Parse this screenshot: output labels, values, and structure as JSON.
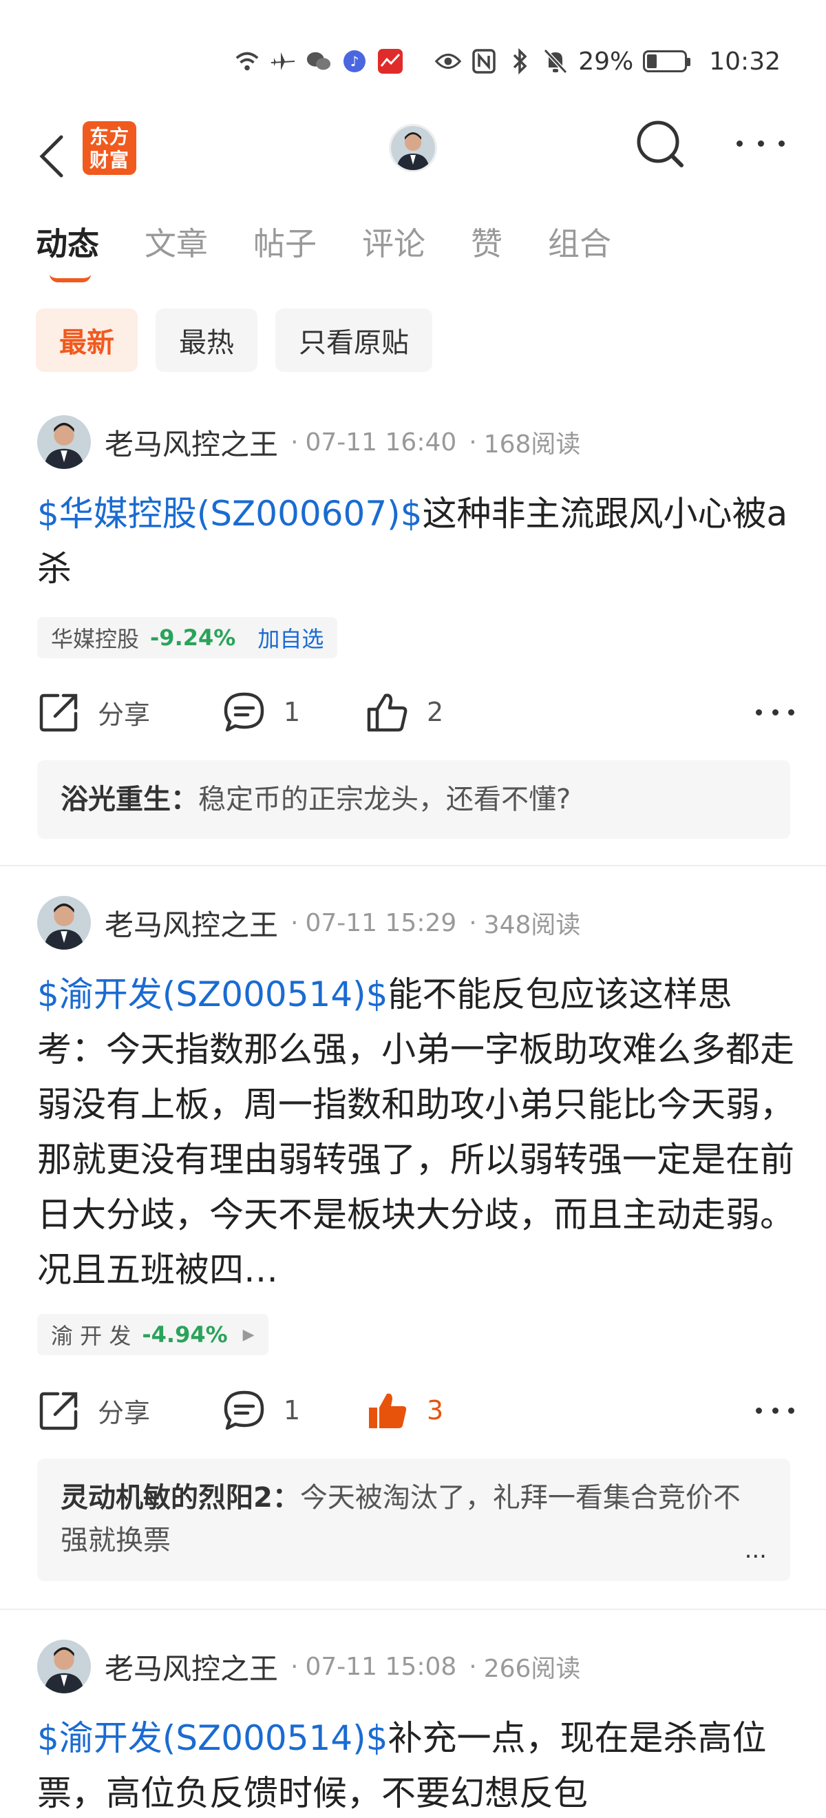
{
  "status_bar": {
    "battery": "29%",
    "time": "10:32"
  },
  "header": {
    "logo_line1": "东方",
    "logo_line2": "财富"
  },
  "tabs": [
    {
      "label": "动态",
      "active": true
    },
    {
      "label": "文章"
    },
    {
      "label": "帖子"
    },
    {
      "label": "评论"
    },
    {
      "label": "赞"
    },
    {
      "label": "组合"
    }
  ],
  "filters": [
    {
      "label": "最新",
      "active": true
    },
    {
      "label": "最热"
    },
    {
      "label": "只看原贴"
    }
  ],
  "posts": [
    {
      "author": "老马风控之王",
      "date": "07-11 16:40",
      "reads": "168阅读",
      "stock_link": "$华媒控股(SZ000607)$",
      "text": "这种非主流跟风小心被a杀",
      "tag_name": "华媒控股",
      "tag_pct": "-9.24%",
      "tag_action": "加自选",
      "share_label": "分享",
      "comments": "1",
      "likes": "2",
      "comment_author": "浴光重生：",
      "comment_text": "稳定币的正宗龙头，还看不懂?"
    },
    {
      "author": "老马风控之王",
      "date": "07-11 15:29",
      "reads": "348阅读",
      "stock_link": "$渝开发(SZ000514)$",
      "text": "能不能反包应该这样思考：今天指数那么强，小弟一字板助攻难么多都走弱没有上板，周一指数和助攻小弟只能比今天弱，那就更没有理由弱转强了，所以弱转强一定是在前日大分歧，今天不是板块大分歧，而且主动走弱。况且五班被四…",
      "tag_name": "渝 开 发",
      "tag_pct": "-4.94%",
      "share_label": "分享",
      "comments": "1",
      "likes": "3",
      "comment_author": "灵动机敏的烈阳2：",
      "comment_text": "今天被淘汰了，礼拜一看集合竞价不强就换票",
      "comment_more": "..."
    },
    {
      "author": "老马风控之王",
      "date": "07-11 15:08",
      "reads": "266阅读",
      "stock_link": "$渝开发(SZ000514)$",
      "text": "补充一点，现在是杀高位票，高位负反馈时候，不要幻想反包"
    }
  ],
  "colors": {
    "accent": "#f05a1e",
    "link": "#1a6bd1",
    "down": "#2aa35a",
    "liked": "#e8530c"
  }
}
